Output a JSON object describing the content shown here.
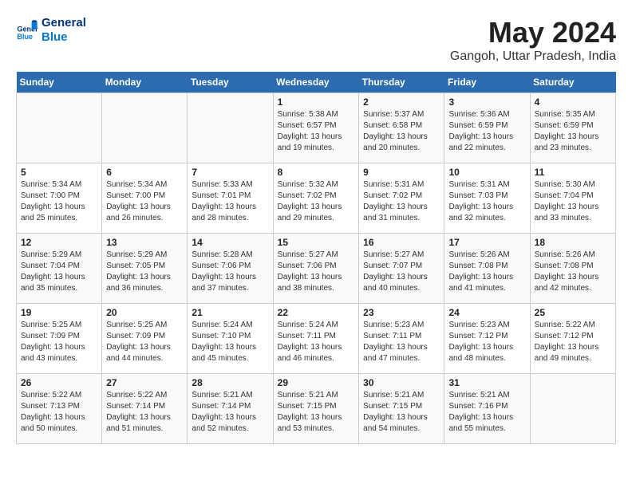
{
  "header": {
    "logo_line1": "General",
    "logo_line2": "Blue",
    "month_year": "May 2024",
    "location": "Gangoh, Uttar Pradesh, India"
  },
  "days_of_week": [
    "Sunday",
    "Monday",
    "Tuesday",
    "Wednesday",
    "Thursday",
    "Friday",
    "Saturday"
  ],
  "weeks": [
    [
      {
        "day": "",
        "info": ""
      },
      {
        "day": "",
        "info": ""
      },
      {
        "day": "",
        "info": ""
      },
      {
        "day": "1",
        "info": "Sunrise: 5:38 AM\nSunset: 6:57 PM\nDaylight: 13 hours\nand 19 minutes."
      },
      {
        "day": "2",
        "info": "Sunrise: 5:37 AM\nSunset: 6:58 PM\nDaylight: 13 hours\nand 20 minutes."
      },
      {
        "day": "3",
        "info": "Sunrise: 5:36 AM\nSunset: 6:59 PM\nDaylight: 13 hours\nand 22 minutes."
      },
      {
        "day": "4",
        "info": "Sunrise: 5:35 AM\nSunset: 6:59 PM\nDaylight: 13 hours\nand 23 minutes."
      }
    ],
    [
      {
        "day": "5",
        "info": "Sunrise: 5:34 AM\nSunset: 7:00 PM\nDaylight: 13 hours\nand 25 minutes."
      },
      {
        "day": "6",
        "info": "Sunrise: 5:34 AM\nSunset: 7:00 PM\nDaylight: 13 hours\nand 26 minutes."
      },
      {
        "day": "7",
        "info": "Sunrise: 5:33 AM\nSunset: 7:01 PM\nDaylight: 13 hours\nand 28 minutes."
      },
      {
        "day": "8",
        "info": "Sunrise: 5:32 AM\nSunset: 7:02 PM\nDaylight: 13 hours\nand 29 minutes."
      },
      {
        "day": "9",
        "info": "Sunrise: 5:31 AM\nSunset: 7:02 PM\nDaylight: 13 hours\nand 31 minutes."
      },
      {
        "day": "10",
        "info": "Sunrise: 5:31 AM\nSunset: 7:03 PM\nDaylight: 13 hours\nand 32 minutes."
      },
      {
        "day": "11",
        "info": "Sunrise: 5:30 AM\nSunset: 7:04 PM\nDaylight: 13 hours\nand 33 minutes."
      }
    ],
    [
      {
        "day": "12",
        "info": "Sunrise: 5:29 AM\nSunset: 7:04 PM\nDaylight: 13 hours\nand 35 minutes."
      },
      {
        "day": "13",
        "info": "Sunrise: 5:29 AM\nSunset: 7:05 PM\nDaylight: 13 hours\nand 36 minutes."
      },
      {
        "day": "14",
        "info": "Sunrise: 5:28 AM\nSunset: 7:06 PM\nDaylight: 13 hours\nand 37 minutes."
      },
      {
        "day": "15",
        "info": "Sunrise: 5:27 AM\nSunset: 7:06 PM\nDaylight: 13 hours\nand 38 minutes."
      },
      {
        "day": "16",
        "info": "Sunrise: 5:27 AM\nSunset: 7:07 PM\nDaylight: 13 hours\nand 40 minutes."
      },
      {
        "day": "17",
        "info": "Sunrise: 5:26 AM\nSunset: 7:08 PM\nDaylight: 13 hours\nand 41 minutes."
      },
      {
        "day": "18",
        "info": "Sunrise: 5:26 AM\nSunset: 7:08 PM\nDaylight: 13 hours\nand 42 minutes."
      }
    ],
    [
      {
        "day": "19",
        "info": "Sunrise: 5:25 AM\nSunset: 7:09 PM\nDaylight: 13 hours\nand 43 minutes."
      },
      {
        "day": "20",
        "info": "Sunrise: 5:25 AM\nSunset: 7:09 PM\nDaylight: 13 hours\nand 44 minutes."
      },
      {
        "day": "21",
        "info": "Sunrise: 5:24 AM\nSunset: 7:10 PM\nDaylight: 13 hours\nand 45 minutes."
      },
      {
        "day": "22",
        "info": "Sunrise: 5:24 AM\nSunset: 7:11 PM\nDaylight: 13 hours\nand 46 minutes."
      },
      {
        "day": "23",
        "info": "Sunrise: 5:23 AM\nSunset: 7:11 PM\nDaylight: 13 hours\nand 47 minutes."
      },
      {
        "day": "24",
        "info": "Sunrise: 5:23 AM\nSunset: 7:12 PM\nDaylight: 13 hours\nand 48 minutes."
      },
      {
        "day": "25",
        "info": "Sunrise: 5:22 AM\nSunset: 7:12 PM\nDaylight: 13 hours\nand 49 minutes."
      }
    ],
    [
      {
        "day": "26",
        "info": "Sunrise: 5:22 AM\nSunset: 7:13 PM\nDaylight: 13 hours\nand 50 minutes."
      },
      {
        "day": "27",
        "info": "Sunrise: 5:22 AM\nSunset: 7:14 PM\nDaylight: 13 hours\nand 51 minutes."
      },
      {
        "day": "28",
        "info": "Sunrise: 5:21 AM\nSunset: 7:14 PM\nDaylight: 13 hours\nand 52 minutes."
      },
      {
        "day": "29",
        "info": "Sunrise: 5:21 AM\nSunset: 7:15 PM\nDaylight: 13 hours\nand 53 minutes."
      },
      {
        "day": "30",
        "info": "Sunrise: 5:21 AM\nSunset: 7:15 PM\nDaylight: 13 hours\nand 54 minutes."
      },
      {
        "day": "31",
        "info": "Sunrise: 5:21 AM\nSunset: 7:16 PM\nDaylight: 13 hours\nand 55 minutes."
      },
      {
        "day": "",
        "info": ""
      }
    ]
  ]
}
